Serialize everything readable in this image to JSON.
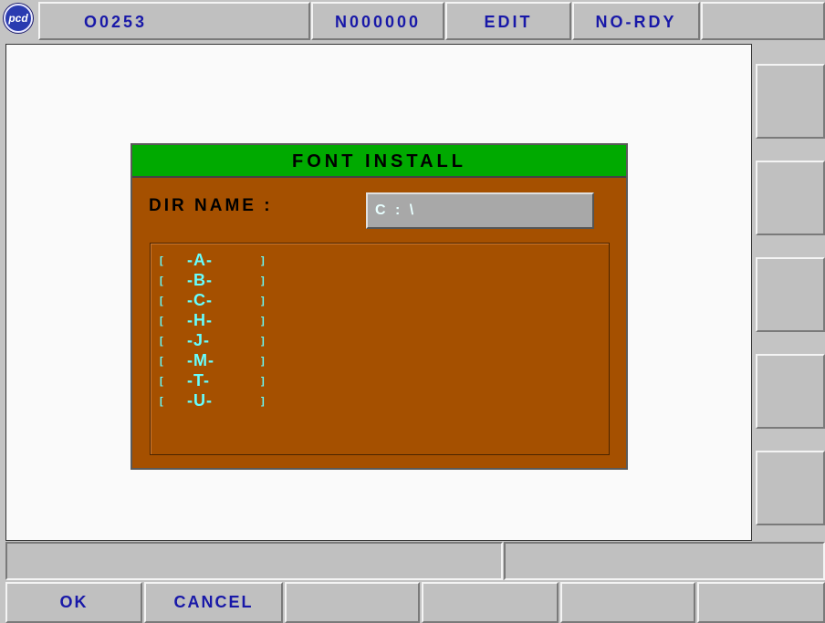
{
  "header": {
    "program": "O0253",
    "sequence": "N000000",
    "mode": "EDIT",
    "status": "NO-RDY",
    "extra": ""
  },
  "logo": {
    "text": "pcd"
  },
  "dialog": {
    "title": "FONT  INSTALL",
    "dir_label": "DIR  NAME  :",
    "dir_value": "C : \\",
    "entries": [
      {
        "open": "[",
        "name": "-A-",
        "close": "]"
      },
      {
        "open": "[",
        "name": "-B-",
        "close": "]"
      },
      {
        "open": "[",
        "name": "-C-",
        "close": "]"
      },
      {
        "open": "[",
        "name": "-H-",
        "close": "]"
      },
      {
        "open": "[",
        "name": "-J-",
        "close": "]"
      },
      {
        "open": "[",
        "name": "-M-",
        "close": "]"
      },
      {
        "open": "[",
        "name": "-T-",
        "close": "]"
      },
      {
        "open": "[",
        "name": "-U-",
        "close": "]"
      }
    ]
  },
  "side_buttons": [
    "",
    "",
    "",
    "",
    ""
  ],
  "status_bar": {
    "left": "",
    "right": ""
  },
  "softkeys": [
    "OK",
    "CANCEL",
    "",
    "",
    "",
    ""
  ],
  "colors": {
    "dialog_bg": "#a55000",
    "title_bg": "#00aa00",
    "entry_text": "#66ffff",
    "header_text": "#1818a8"
  }
}
